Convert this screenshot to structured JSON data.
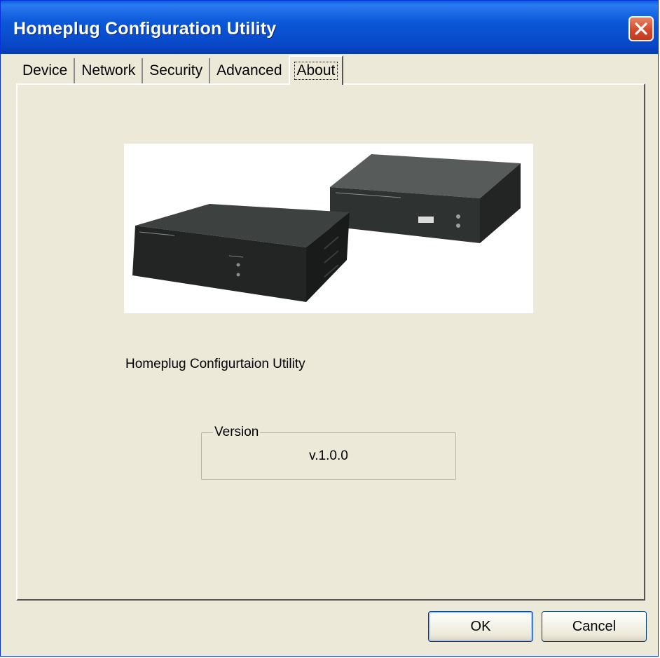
{
  "window": {
    "title": "Homeplug Configuration Utility"
  },
  "tabs": [
    {
      "label": "Device"
    },
    {
      "label": "Network"
    },
    {
      "label": "Security"
    },
    {
      "label": "Advanced"
    },
    {
      "label": "About",
      "active": true
    }
  ],
  "about": {
    "product_name": "Homeplug Configurtaion Utility",
    "version_label": "Version",
    "version_value": "v.1.0.0"
  },
  "buttons": {
    "ok": "OK",
    "cancel": "Cancel"
  },
  "colors": {
    "titlebar": "#0a52d6",
    "face": "#ece9d8",
    "close": "#d5492c"
  }
}
